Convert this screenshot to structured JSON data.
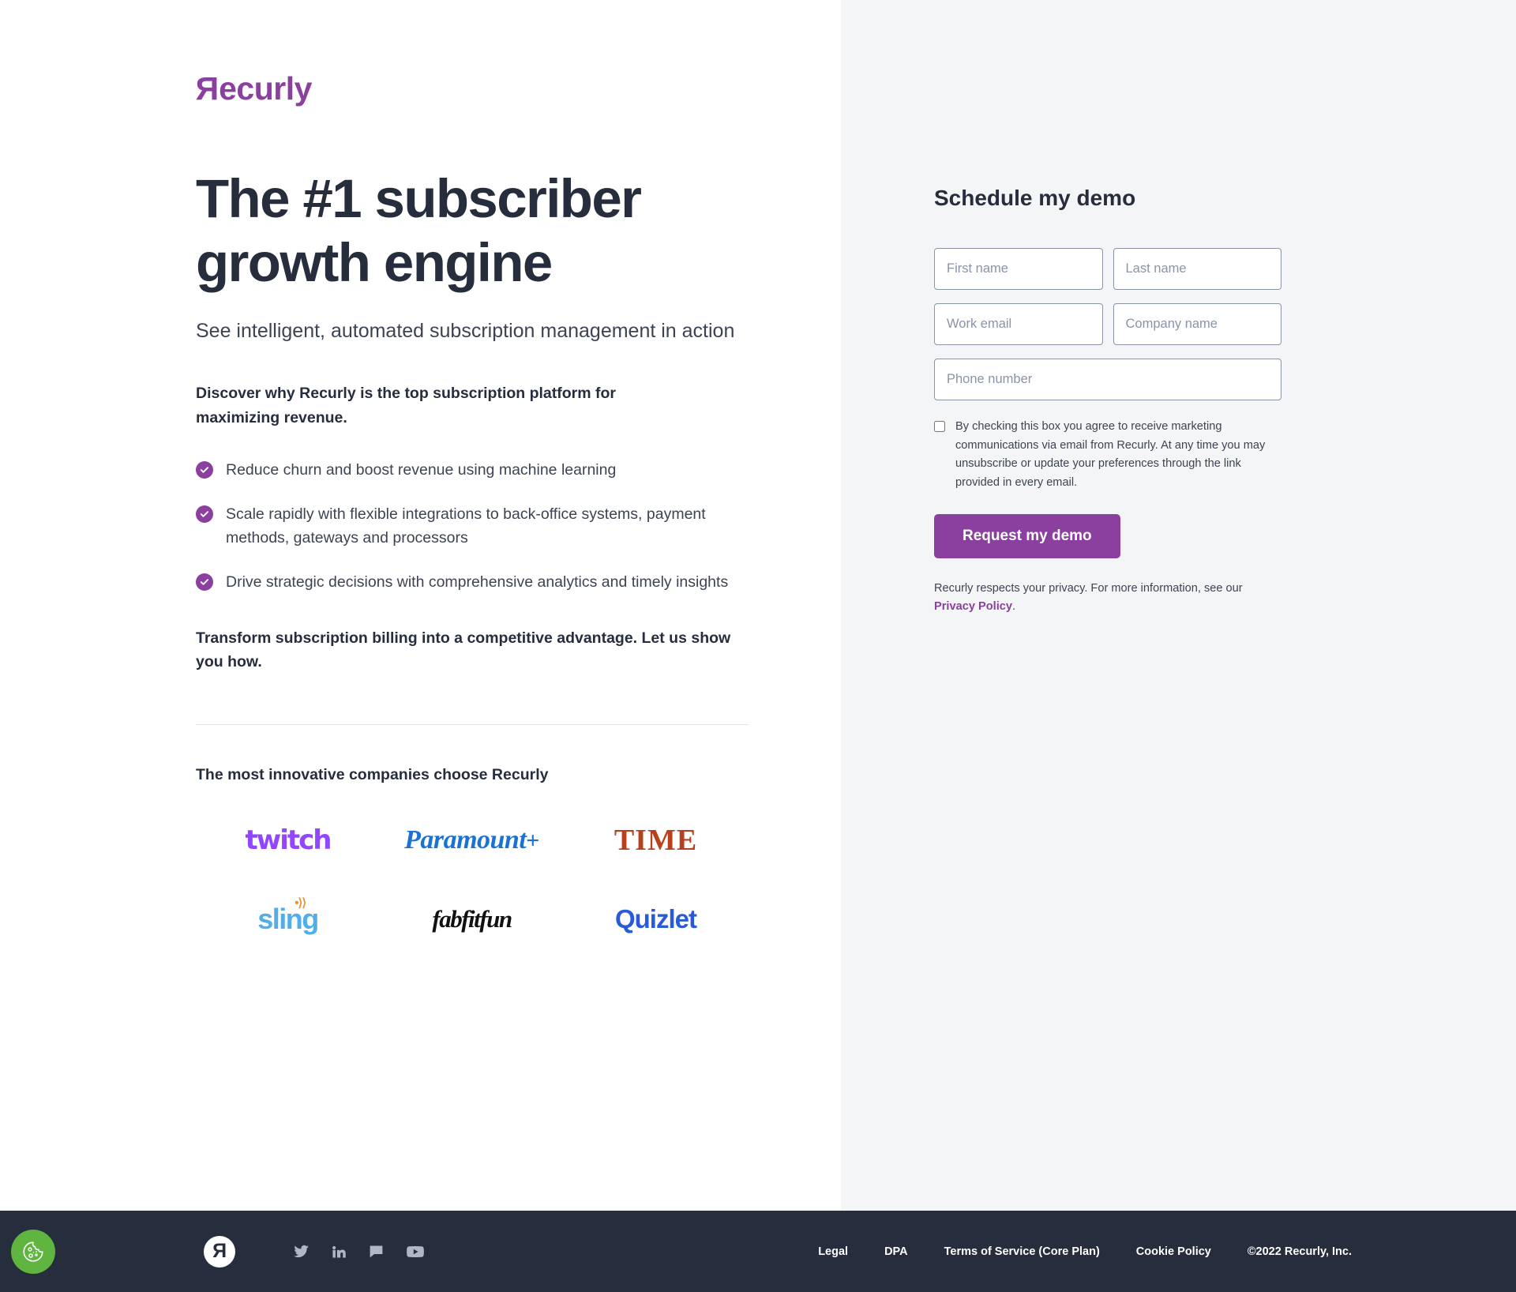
{
  "brand": {
    "name": "Recurly",
    "logo_color": "#8B3F9E",
    "accent_color": "#8B3F9E",
    "dark_color": "#262D3D"
  },
  "hero": {
    "headline": "The #1 subscriber growth engine",
    "subheadline": "See intelligent, automated subscription management in action",
    "lead_bold": "Discover why Recurly is the top subscription platform for maximizing revenue.",
    "benefits": [
      "Reduce churn and boost revenue using machine learning",
      "Scale rapidly with flexible integrations to back-office systems, payment methods, gateways and processors",
      "Drive strategic decisions with comprehensive analytics and timely insights"
    ],
    "closing_bold": "Transform subscription billing into a competitive advantage. Let us show you how."
  },
  "customers": {
    "title": "The most innovative companies choose Recurly",
    "logos": [
      {
        "name": "twitch",
        "label": "twitch",
        "color": "#9146FF"
      },
      {
        "name": "paramount-plus",
        "label": "Paramount",
        "suffix": "+",
        "color": "#1A73D4"
      },
      {
        "name": "time",
        "label": "TIME",
        "color": "#B7411F"
      },
      {
        "name": "sling",
        "label": "sling",
        "color": "#53AEE8"
      },
      {
        "name": "fabfitfun",
        "label": "fabfitfun",
        "color": "#111111"
      },
      {
        "name": "quizlet",
        "label": "Quizlet",
        "color": "#2A5BD7"
      }
    ]
  },
  "form": {
    "title": "Schedule my demo",
    "fields": {
      "first_name": {
        "placeholder": "First name",
        "value": ""
      },
      "last_name": {
        "placeholder": "Last name",
        "value": ""
      },
      "work_email": {
        "placeholder": "Work email",
        "value": ""
      },
      "company_name": {
        "placeholder": "Company name",
        "value": ""
      },
      "phone_number": {
        "placeholder": "Phone number",
        "value": ""
      }
    },
    "consent_text": "By checking this box you agree to receive marketing communications via email from Recurly. At any time you may unsubscribe or update your preferences through the link provided in every email.",
    "consent_checked": false,
    "submit_label": "Request my demo",
    "privacy_prefix": "Recurly respects your privacy. For more information, see our ",
    "privacy_link": "Privacy Policy",
    "privacy_suffix": "."
  },
  "footer": {
    "social": [
      {
        "name": "twitter-icon"
      },
      {
        "name": "linkedin-icon"
      },
      {
        "name": "glassdoor-icon"
      },
      {
        "name": "youtube-icon"
      }
    ],
    "links": [
      {
        "label": "Legal"
      },
      {
        "label": "DPA"
      },
      {
        "label": "Terms of Service (Core Plan)"
      },
      {
        "label": "Cookie Policy"
      }
    ],
    "copyright": "©2022 Recurly, Inc.",
    "cookie_button_color": "#5FB53F"
  }
}
